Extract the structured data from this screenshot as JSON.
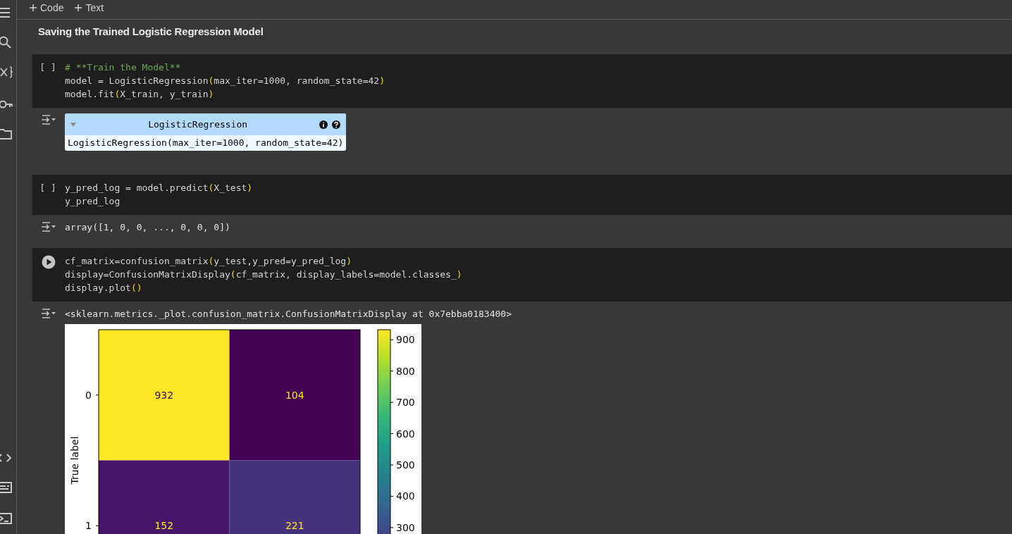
{
  "toolbar": {
    "buttons": [
      {
        "label": "Code"
      },
      {
        "label": "Text"
      }
    ]
  },
  "heading": "Saving the Trained Logistic Regression Model",
  "cells": [
    {
      "prompt": "[ ]",
      "run_button": false,
      "lines": [
        {
          "kind": "comment",
          "text": "# **Train the Model**"
        },
        {
          "kind": "code",
          "text": "model = LogisticRegression(max_iter=1000, random_state=42)"
        },
        {
          "kind": "code",
          "text": "model.fit(X_train, y_train)"
        }
      ],
      "output": {
        "kind": "estimator",
        "title": "LogisticRegression",
        "repr": "LogisticRegression(max_iter=1000, random_state=42)"
      }
    },
    {
      "prompt": "[ ]",
      "run_button": false,
      "lines": [
        {
          "kind": "code",
          "text": "y_pred_log = model.predict(X_test)"
        },
        {
          "kind": "code",
          "text": "y_pred_log"
        }
      ],
      "output": {
        "kind": "text",
        "text": "array([1, 0, 0, ..., 0, 0, 0])"
      }
    },
    {
      "run_button": true,
      "lines": [
        {
          "kind": "code",
          "text": "cf_matrix=confusion_matrix(y_test,y_pred=y_pred_log)"
        },
        {
          "kind": "code",
          "text": "display=ConfusionMatrixDisplay(cf_matrix, display_labels=model.classes_)"
        },
        {
          "kind": "code",
          "text": "display.plot()"
        }
      ],
      "output": {
        "kind": "plot",
        "text": "<sklearn.metrics._plot.confusion_matrix.ConfusionMatrixDisplay at 0x7ebba0183400>",
        "confusion_matrix": {
          "ylabel": "True label",
          "row_ticks": [
            "0",
            "1"
          ],
          "cells": [
            [
              {
                "value": "932",
                "color": "#fde725"
              },
              {
                "value": "104",
                "color": "#440154"
              }
            ],
            [
              {
                "value": "152",
                "color": "#481467"
              },
              {
                "value": "221",
                "color": "#46337e"
              }
            ]
          ],
          "colorbar_ticks": [
            "900",
            "800",
            "700",
            "600",
            "500",
            "400",
            "300"
          ]
        }
      }
    }
  ]
}
